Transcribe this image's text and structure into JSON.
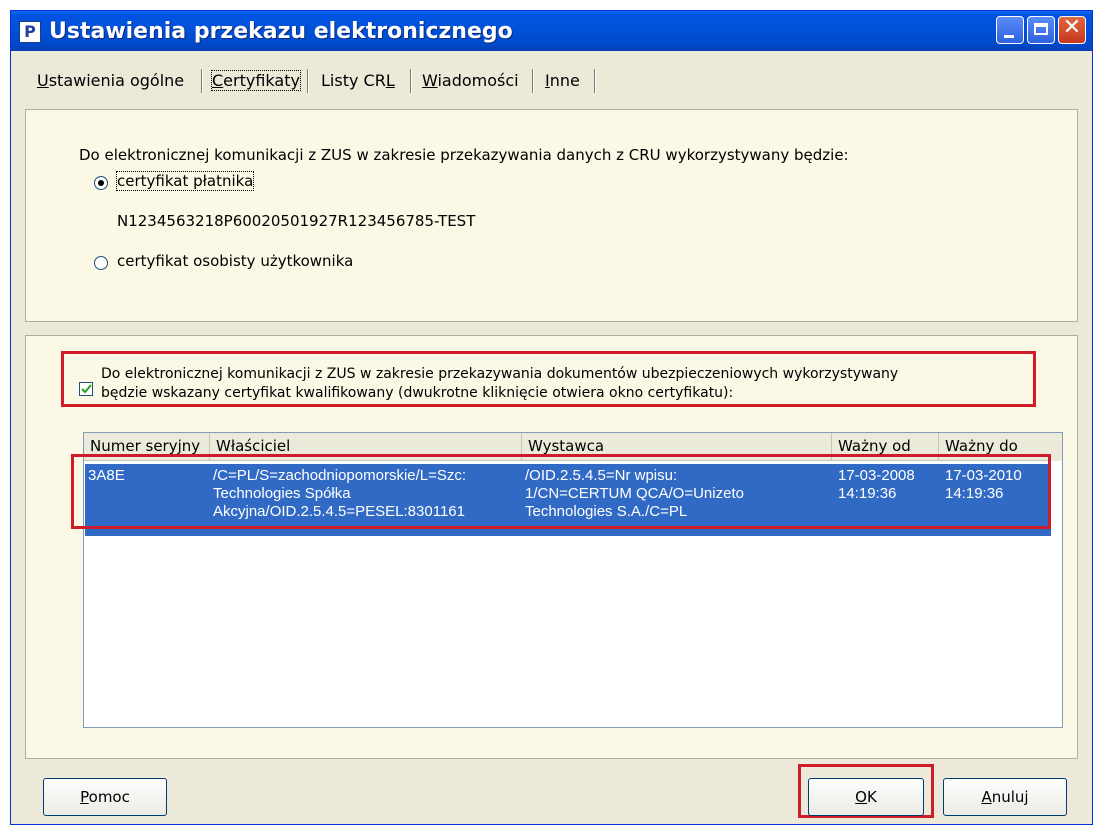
{
  "window": {
    "title": "Ustawienia przekazu elektronicznego",
    "app_icon_glyph": "P"
  },
  "tabs": [
    {
      "label": "Ustawienia ogólne",
      "accel": "U",
      "rest": "stawienia ogólne"
    },
    {
      "label": "Certyfikaty",
      "accel": "C",
      "rest": "ertyfikaty",
      "active": true
    },
    {
      "label": "Listy CRL",
      "pre": "Listy CR",
      "accel": "L",
      "rest": ""
    },
    {
      "label": "Wiadomości",
      "accel": "W",
      "rest": "iadomości"
    },
    {
      "label": "Inne",
      "accel": "I",
      "rest": "nne"
    }
  ],
  "cru_section": {
    "intro": "Do elektronicznej komunikacji z ZUS w zakresie przekazywania danych z CRU wykorzystywany będzie:",
    "option1_label": "certyfikat płatnika",
    "option1_selected": true,
    "cert_id": "N1234563218P60020501927R123456785-TEST",
    "option2_label": "certyfikat osobisty użytkownika",
    "option2_selected": false
  },
  "doc_section": {
    "checkbox_checked": true,
    "checkbox_line1": "Do elektronicznej komunikacji z ZUS w zakresie przekazywania dokumentów ubezpieczeniowych wykorzystywany",
    "checkbox_line2": "będzie wskazany certyfikat kwalifikowany (dwukrotne kliknięcie otwiera okno certyfikatu):"
  },
  "table": {
    "columns": [
      "Numer seryjny",
      "Właściciel",
      "Wystawca",
      "Ważny od",
      "Ważny do"
    ],
    "rows": [
      {
        "serial": "3A8E",
        "owner": "/C=PL/S=zachodniopomorskie/L=Szc:\nTechnologies Spółka\nAkcyjna/OID.2.5.4.5=PESEL:8301161",
        "issuer": "/OID.2.5.4.5=Nr wpisu:\n1/CN=CERTUM QCA/O=Unizeto\nTechnologies S.A./C=PL",
        "valid_from": "17-03-2008\n14:19:36",
        "valid_to": "17-03-2010\n14:19:36",
        "selected": true
      }
    ]
  },
  "buttons": {
    "help": {
      "accel": "P",
      "rest": "omoc"
    },
    "ok": {
      "accel": "O",
      "rest": "K"
    },
    "cancel": {
      "accel": "A",
      "rest": "nuluj"
    }
  },
  "colors": {
    "highlight_red": "#d01c2a",
    "selection_blue": "#316ac5",
    "panel_bg": "#fbf8e5",
    "window_bg": "#ece9d8"
  }
}
